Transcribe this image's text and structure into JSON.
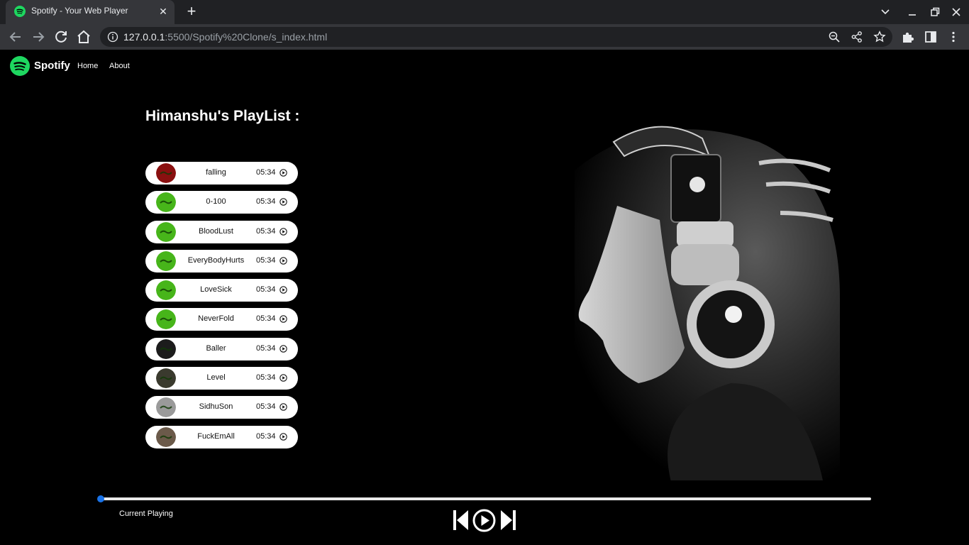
{
  "browser": {
    "tab_title": "Spotify - Your Web Player",
    "url_host": "127.0.0.1",
    "url_path": ":5500/Spotify%20Clone/s_index.html"
  },
  "nav": {
    "brand": "Spotify",
    "links": [
      "Home",
      "About"
    ]
  },
  "playlist": {
    "title": "Himanshu's PlayList :",
    "songs": [
      {
        "name": "falling",
        "duration": "05:34",
        "thumb": "red"
      },
      {
        "name": "0-100",
        "duration": "05:34",
        "thumb": "green"
      },
      {
        "name": "BloodLust",
        "duration": "05:34",
        "thumb": "green"
      },
      {
        "name": "EveryBodyHurts",
        "duration": "05:34",
        "thumb": "green"
      },
      {
        "name": "LoveSick",
        "duration": "05:34",
        "thumb": "green"
      },
      {
        "name": "NeverFold",
        "duration": "05:34",
        "thumb": "green"
      },
      {
        "name": "Baller",
        "duration": "05:34",
        "thumb": "dark"
      },
      {
        "name": "Level",
        "duration": "05:34",
        "thumb": "photo"
      },
      {
        "name": "SidhuSon",
        "duration": "05:34",
        "thumb": "grey"
      },
      {
        "name": "FuckEmAll",
        "duration": "05:34",
        "thumb": "brown"
      }
    ]
  },
  "player": {
    "current_label": "Current Playing",
    "progress": 0
  },
  "colors": {
    "spotify_green": "#1ed760",
    "accent_blue": "#1a73e8"
  }
}
